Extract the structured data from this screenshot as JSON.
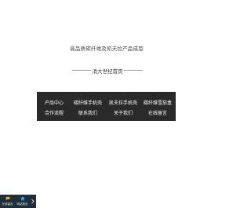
{
  "tagline": "高品质碳纤维及凯夫拉产品成型",
  "home_link": "消大世纪首页",
  "nav": {
    "row1": [
      "产品中心",
      "碳纤维手机壳",
      "凯夫拉手机壳",
      "碳纤维雪茄盒"
    ],
    "row2": [
      "合作流程",
      "联系我们",
      "关于我们",
      "在线留言"
    ]
  },
  "bottom_bar": {
    "buttons": [
      {
        "label": "在线留言",
        "icon": "chat-icon"
      },
      {
        "label": "网站首页",
        "icon": "home-icon"
      }
    ],
    "arrow_icon": "chevron-right-icon",
    "bg_color": "#1f2f3a"
  },
  "colors": {
    "nav_bg": "#2a2a2a",
    "text": "#444444"
  }
}
